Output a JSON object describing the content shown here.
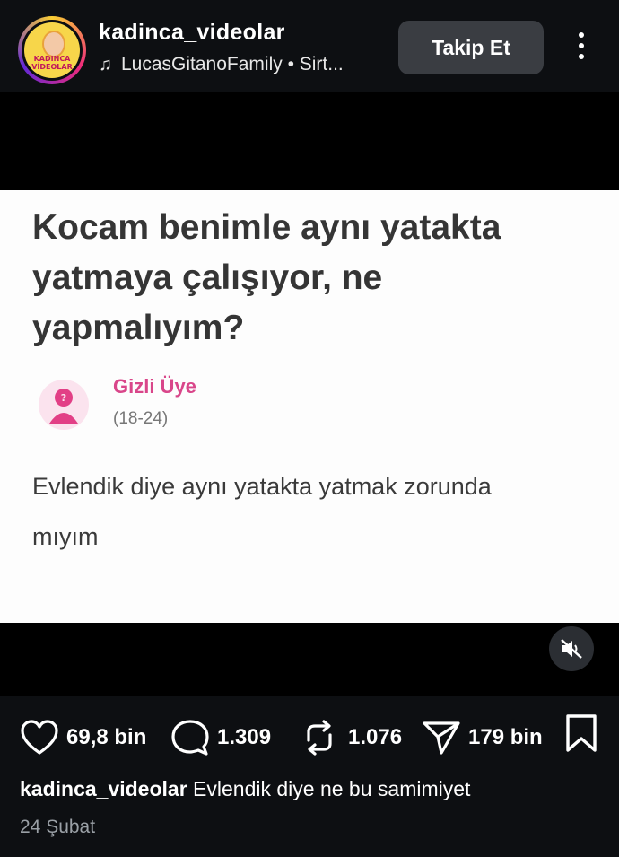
{
  "header": {
    "username": "kadinca_videolar",
    "avatar_text": "KADINCA VİDEOLAR",
    "music_icon": "music-note-icon",
    "music_label": "LucasGitanoFamily • Sirt...",
    "follow_label": "Takip Et",
    "more_icon": "more-vertical-icon"
  },
  "video": {
    "question_lines": [
      "Kocam benimle aynı yatakta",
      "yatmaya çalışıyor, ne",
      "yapmalıyım?"
    ],
    "member_name": "Gizli Üye",
    "member_age": "(18-24)",
    "answer_lines": [
      "Evlendik diye aynı yatakta yatmak zorunda",
      "mıyım"
    ],
    "mute_icon": "muted-speaker-icon"
  },
  "actions": {
    "likes": "69,8 bin",
    "comments": "1.309",
    "reposts": "1.076",
    "shares": "179 bin"
  },
  "caption": {
    "username": "kadinca_videolar",
    "text": "Evlendik diye ne bu samimiyet"
  },
  "date": "24 Şubat",
  "colors": {
    "background": "#0d0f12",
    "follow_button": "#3a3d42",
    "member_accent": "#d9468a"
  }
}
